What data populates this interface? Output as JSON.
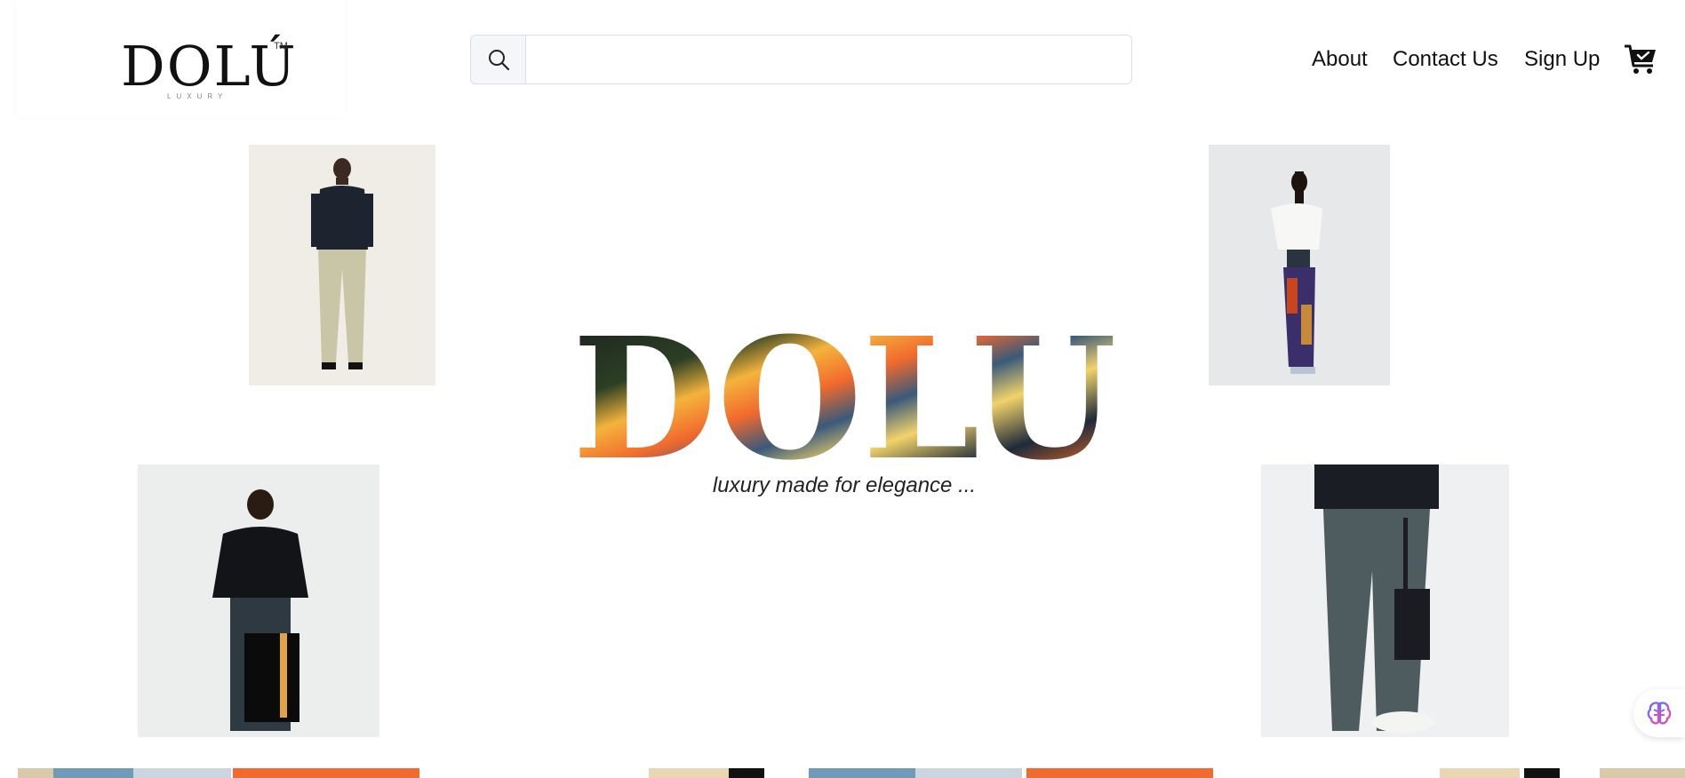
{
  "header": {
    "logo": {
      "wordmark": "DOLÚ",
      "tm": "TM",
      "sub": "LUXURY"
    },
    "search": {
      "icon": "search-icon",
      "placeholder": "",
      "value": ""
    },
    "nav": [
      {
        "label": "About"
      },
      {
        "label": "Contact Us"
      },
      {
        "label": "Sign Up"
      }
    ],
    "cart_icon": "cart-check-icon"
  },
  "hero": {
    "title": "DOLU",
    "tagline": "luxury made for elegance ..."
  },
  "photos": [
    {
      "name": "model-man-plaid-trousers"
    },
    {
      "name": "model-woman-print-pants"
    },
    {
      "name": "model-man-tote-bag"
    },
    {
      "name": "model-cargo-pants-bag"
    }
  ],
  "floating_button": {
    "icon": "brain-icon"
  },
  "colors": {
    "accent_orange": "#f26a2e",
    "search_border": "#d9dee5",
    "text": "#111111"
  }
}
